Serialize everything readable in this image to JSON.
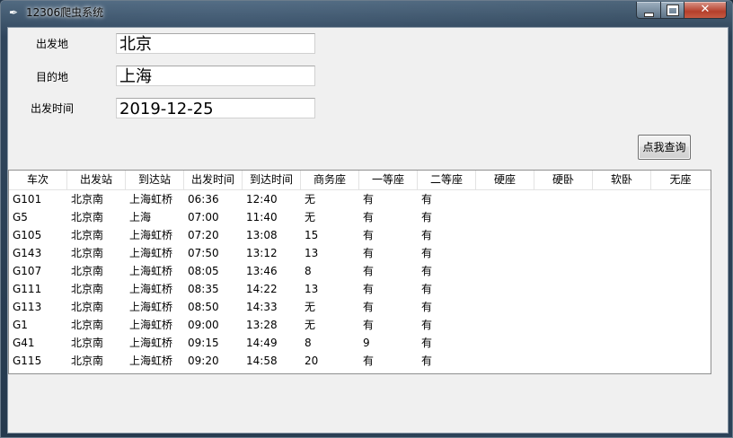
{
  "window": {
    "title": "12306爬虫系统",
    "app_icon": "feather-icon",
    "controls": {
      "minimize": "minimize-icon",
      "maximize": "maximize-icon",
      "close": "close-icon"
    }
  },
  "form": {
    "departure_label": "出发地",
    "departure_value": "北京",
    "destination_label": "目的地",
    "destination_value": "上海",
    "date_label": "出发时间",
    "date_value": "2019-12-25",
    "query_button": "点我查询"
  },
  "table": {
    "columns": [
      "车次",
      "出发站",
      "到达站",
      "出发时间",
      "到达时间",
      "商务座",
      "一等座",
      "二等座",
      "硬座",
      "硬卧",
      "软卧",
      "无座"
    ],
    "rows": [
      [
        "G101",
        "北京南",
        "上海虹桥",
        "06:36",
        "12:40",
        "无",
        "有",
        "有",
        "",
        "",
        "",
        ""
      ],
      [
        "G5",
        "北京南",
        "上海",
        "07:00",
        "11:40",
        "无",
        "有",
        "有",
        "",
        "",
        "",
        ""
      ],
      [
        "G105",
        "北京南",
        "上海虹桥",
        "07:20",
        "13:08",
        "15",
        "有",
        "有",
        "",
        "",
        "",
        ""
      ],
      [
        "G143",
        "北京南",
        "上海虹桥",
        "07:50",
        "13:12",
        "13",
        "有",
        "有",
        "",
        "",
        "",
        ""
      ],
      [
        "G107",
        "北京南",
        "上海虹桥",
        "08:05",
        "13:46",
        "8",
        "有",
        "有",
        "",
        "",
        "",
        ""
      ],
      [
        "G111",
        "北京南",
        "上海虹桥",
        "08:35",
        "14:22",
        "13",
        "有",
        "有",
        "",
        "",
        "",
        ""
      ],
      [
        "G113",
        "北京南",
        "上海虹桥",
        "08:50",
        "14:33",
        "无",
        "有",
        "有",
        "",
        "",
        "",
        ""
      ],
      [
        "G1",
        "北京南",
        "上海虹桥",
        "09:00",
        "13:28",
        "无",
        "有",
        "有",
        "",
        "",
        "",
        ""
      ],
      [
        "G41",
        "北京南",
        "上海虹桥",
        "09:15",
        "14:49",
        "8",
        "9",
        "有",
        "",
        "",
        "",
        ""
      ],
      [
        "G115",
        "北京南",
        "上海虹桥",
        "09:20",
        "14:58",
        "20",
        "有",
        "有",
        "",
        "",
        "",
        ""
      ]
    ]
  }
}
